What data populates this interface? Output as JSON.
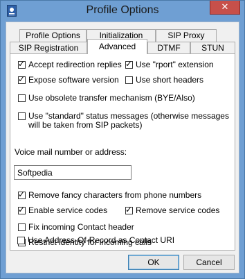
{
  "window": {
    "title": "Profile Options",
    "close_label": "✕"
  },
  "tabs_row1": [
    "Profile Options",
    "Initialization",
    "SIP Proxy"
  ],
  "tabs_row2": [
    "SIP Registration",
    "Advanced",
    "DTMF",
    "STUN"
  ],
  "options": {
    "accept_redirection": {
      "label": "Accept redirection replies",
      "checked": true
    },
    "use_rport": {
      "label": "Use \"rport\" extension",
      "checked": true
    },
    "expose_version": {
      "label": "Expose software version",
      "checked": true
    },
    "short_headers": {
      "label": "Use short headers",
      "checked": false
    },
    "obsolete_transfer": {
      "label": "Use obsolete transfer mechanism (BYE/Also)",
      "checked": false
    },
    "standard_status": {
      "label": "Use \"standard\" status messages (otherwise messages will be taken from SIP packets)",
      "checked": false
    },
    "voicemail_label": "Voice mail number or address:",
    "voicemail_value": "Softpedia",
    "remove_fancy": {
      "label": "Remove fancy characters from phone numbers",
      "checked": true
    },
    "enable_codes": {
      "label": "Enable service codes",
      "checked": true
    },
    "remove_codes": {
      "label": "Remove service codes",
      "checked": true
    },
    "fix_contact": {
      "label": "Fix incoming Contact header",
      "checked": false
    },
    "restrict_identity": {
      "label": "Restrict identity for incoming calls",
      "checked": false
    },
    "use_aor": {
      "label": "Use Address-Of-Record as Contact URI",
      "checked": false
    }
  },
  "buttons": {
    "ok": "OK",
    "cancel": "Cancel"
  },
  "check_glyph": "✓"
}
